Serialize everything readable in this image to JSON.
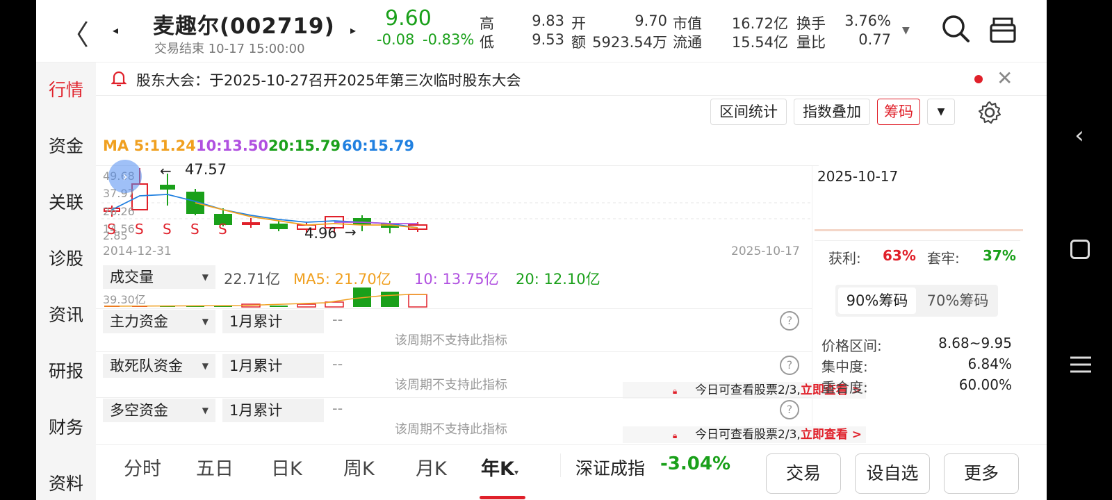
{
  "header": {
    "title": "麦趣尔(002719)",
    "subtitle": "交易结束 10-17 15:00:00",
    "price": "9.60",
    "change": "-0.08",
    "change_pct": "-0.83%",
    "high_label": "高",
    "high": "9.83",
    "low_label": "低",
    "low": "9.53",
    "open_label": "开",
    "open": "9.70",
    "amount_label": "额",
    "amount": "5923.54万",
    "mktcap_label": "市值",
    "mktcap": "16.72亿",
    "float_label": "流通",
    "float": "15.54亿",
    "turnover_label": "换手",
    "turnover": "3.76%",
    "volratio_label": "量比",
    "volratio": "0.77"
  },
  "left_nav": [
    "行情",
    "资金",
    "关联",
    "诊股",
    "资讯",
    "研报",
    "财务",
    "资料"
  ],
  "notice": {
    "text": "股东大会：于2025-10-27召开2025年第三次临时股东大会"
  },
  "toolbar": {
    "interval": "区间统计",
    "index_overlay": "指数叠加",
    "chips": "筹码"
  },
  "ma": {
    "ma5": "MA 5:11.24",
    "ma10": "10:13.50",
    "ma20": "20:15.79",
    "ma60": "60:15.79"
  },
  "chart": {
    "y_labels": [
      "49.68",
      "37.97",
      "26.26",
      "14.56",
      "2.85"
    ],
    "max_marker": "47.57",
    "min_marker": "4.96",
    "date_start": "2014-12-31",
    "date_end": "2025-10-17",
    "s_marker": "S"
  },
  "colors": {
    "up": "#e0202a",
    "down": "#1aa01a",
    "ma5": "#f0a020",
    "ma10": "#b050e0",
    "ma20": "#1aa01a",
    "ma60": "#2080e0"
  },
  "volume": {
    "selector": "成交量",
    "value": "22.71亿",
    "ma5": "MA5: 21.70亿",
    "ma10": "10: 13.75亿",
    "ma20": "20: 12.10亿",
    "max_label": "39.30亿"
  },
  "indicators": [
    {
      "name": "主力资金",
      "period": "1月累计",
      "value": "--",
      "msg": "该周期不支持此指标"
    },
    {
      "name": "敢死队资金",
      "period": "1月累计",
      "value": "--",
      "msg": "该周期不支持此指标",
      "lock": "今日可查看股票2/3,",
      "lock_link": "立即查看 >"
    },
    {
      "name": "多空资金",
      "period": "1月累计",
      "value": "--",
      "msg": "该周期不支持此指标",
      "lock": "今日可查看股票2/3,",
      "lock_link": "立即查看 >"
    }
  ],
  "right_panel": {
    "date": "2025-10-17",
    "profit_label": "获利:",
    "profit": "63%",
    "trapped_label": "套牢:",
    "trapped": "37%",
    "tab90": "90%筹码",
    "tab70": "70%筹码",
    "range_label": "价格区间:",
    "range": "8.68~9.95",
    "conc_label": "集中度:",
    "conc": "6.84%",
    "overlap_label": "重合度:",
    "overlap": "60.00%"
  },
  "tabs": [
    "分时",
    "五日",
    "日K",
    "周K",
    "月K",
    "年K"
  ],
  "index": {
    "name": "深证成指",
    "change": "-3.04%"
  },
  "actions": {
    "trade": "交易",
    "watch": "设自选",
    "more": "更多"
  }
}
